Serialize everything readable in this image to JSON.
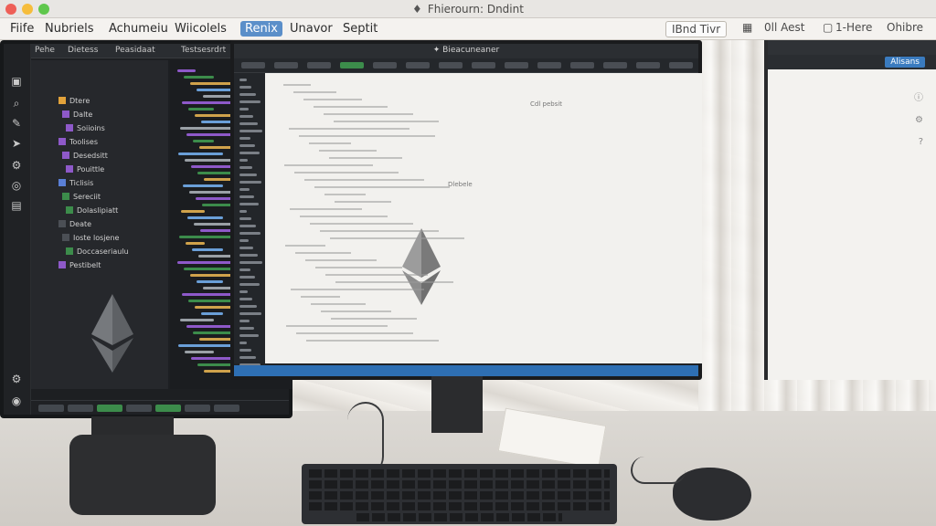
{
  "window": {
    "title": "Fhierourn: Dndint"
  },
  "menu": {
    "items": [
      "Fiife",
      "Nubriels",
      "Achumeiu",
      "Wiicolels",
      "Renix",
      "Unavor",
      "Septit"
    ],
    "active_index": 4,
    "right": {
      "pill": "IBnd Tivr",
      "item_1": "0ll Aest",
      "item_2": "1-Here",
      "item_3": "Ohibre"
    }
  },
  "left_editor": {
    "tabs": [
      "Pehe",
      "Dietess",
      "Peasidaat",
      "Testsesrdrt"
    ],
    "tree_items": [
      {
        "label": "Dtere",
        "color": "#e1a23a"
      },
      {
        "label": "Dalte",
        "color": "#8e59c9"
      },
      {
        "label": "Soiioins",
        "color": "#8e59c9"
      },
      {
        "label": "Toolises",
        "color": "#8e59c9"
      },
      {
        "label": "Desedsitt",
        "color": "#8e59c9"
      },
      {
        "label": "Pouittle",
        "color": "#8e59c9"
      },
      {
        "label": "Ticlisis",
        "color": "#5a7fd6"
      },
      {
        "label": "Sereciit",
        "color": "#3c8c4b"
      },
      {
        "label": "Dolaslipiatt",
        "color": "#3c8c4b"
      },
      {
        "label": "Deate",
        "color": "#4b4f55"
      },
      {
        "label": "Ioste losjene",
        "color": "#4b4f55"
      },
      {
        "label": "Doccaseriaulu",
        "color": "#3c8c4b"
      },
      {
        "label": "Pestibelt",
        "color": "#8e59c9"
      }
    ]
  },
  "main_editor": {
    "title": "Bieacuneaner",
    "doc_labels": [
      "Cdl pebsit",
      "Dlebele"
    ],
    "status_color": "#2e6fb3"
  },
  "right_panel": {
    "button": "Alisans"
  },
  "colors": {
    "accent": "#5b8fc9",
    "editor_bg": "#202225",
    "doc_bg": "#f2f1ee"
  }
}
